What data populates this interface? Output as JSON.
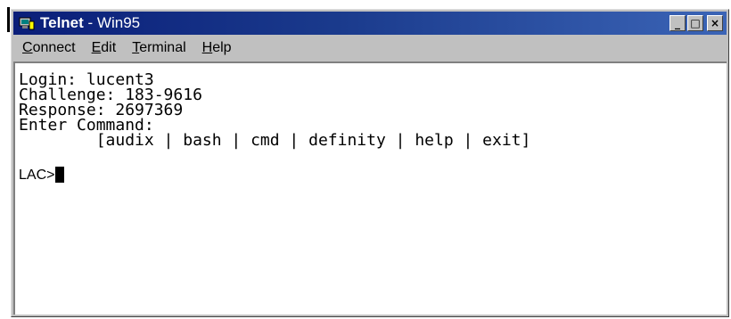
{
  "window": {
    "title_app": "Telnet",
    "title_rest": " - Win95",
    "icon": "telnet-app-icon",
    "buttons": {
      "minimize": "_",
      "maximize": "□",
      "close": "×"
    }
  },
  "menubar": {
    "items": [
      {
        "first": "C",
        "rest": "onnect"
      },
      {
        "first": "E",
        "rest": "dit"
      },
      {
        "first": "T",
        "rest": "erminal"
      },
      {
        "first": "H",
        "rest": "elp"
      }
    ]
  },
  "terminal": {
    "lines": [
      "Login: lucent3",
      "Challenge: 183-9616",
      "Response: 2697369",
      "Enter Command:",
      "        [audix | bash | cmd | definity | help | exit]"
    ],
    "prompt": "LAC>"
  },
  "colors": {
    "titlebar_start": "#0a1e79",
    "titlebar_end": "#3b64b6",
    "window_face": "#c0c0c0",
    "terminal_bg": "#ffffff",
    "terminal_text": "#000000"
  }
}
